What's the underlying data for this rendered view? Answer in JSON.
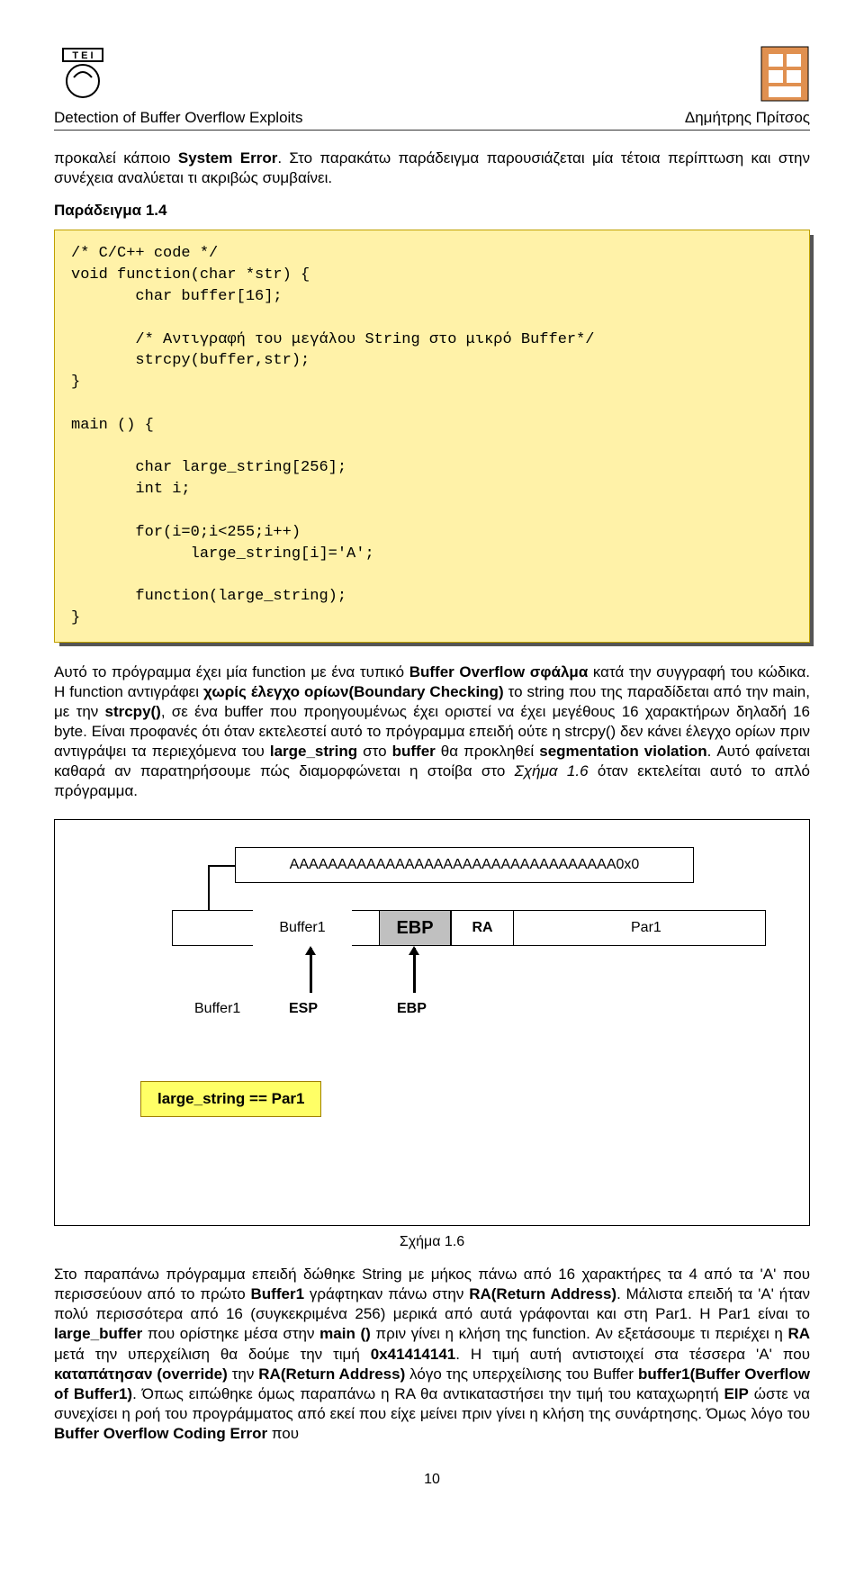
{
  "header": {
    "title_left": "Detection of Buffer Overflow Exploits",
    "title_right": "Δημήτρης Πρίτσος"
  },
  "intro_para": {
    "t1": "προκαλεί κάποιο ",
    "b1": "System Error",
    "t2": ". Στο παρακάτω παράδειγμα παρουσιάζεται μία τέτοια περίπτωση και στην συνέχεια αναλύεται τι ακριβώς συμβαίνει."
  },
  "example_label": "Παράδειγμα 1.4",
  "code": "/* C/C++ code */\nvoid function(char *str) {\n       char buffer[16];\n\n       /* Αντιγραφή του μεγάλου String στο μικρό Buffer*/\n       strcpy(buffer,str);\n}\n\nmain () {\n\n       char large_string[256];\n       int i;\n\n       for(i=0;i<255;i++)\n             large_string[i]='A';\n\n       function(large_string);\n}",
  "para2": {
    "t1": "Αυτό το πρόγραμμα έχει μία function με ένα τυπικό ",
    "b1": "Buffer Overflow σφάλμα",
    "t2": " κατά την συγγραφή του κώδικα. Η function αντιγράφει ",
    "b2": "χωρίς έλεγχο ορίων(Boundary Checking)",
    "t3": " το string που της παραδίδεται από την main, με την ",
    "b3": "strcpy()",
    "t4": ", σε ένα buffer που προηγουμένως έχει οριστεί να έχει μεγέθους 16 χαρακτήρων δηλαδή 16 byte. Είναι προφανές ότι όταν εκτελεστεί αυτό το πρόγραμμα επειδή ούτε η strcpy() δεν κάνει έλεγχο ορίων πριν αντιγράψει τα περιεχόμενα του ",
    "b4": "large_string",
    "t5": " στο ",
    "b5": "buffer",
    "t6": " θα προκληθεί ",
    "b6": "segmentation violation",
    "t7": ". Αυτό φαίνεται καθαρά αν παρατηρήσουμε πώς διαμορφώνεται η στοίβα στο ",
    "i1": "Σχήμα 1.6",
    "t8": " όταν εκτελείται αυτό το απλό πρόγραμμα."
  },
  "diagram": {
    "aaaa": "AAAAAAAAAAAAAAAAAAAAAAAAAAAAAAAAAA0x0",
    "buffer1a": "Buffer1",
    "ebp_box": "EBP",
    "ra": "RA",
    "par1": "Par1",
    "buffer1b": "Buffer1",
    "esp": "ESP",
    "ebp_lbl": "EBP",
    "large_string": "large_string == Par1"
  },
  "caption": "Σχήμα 1.6",
  "para3": {
    "t1": "Στο παραπάνω πρόγραμμα επειδή δώθηκε String με μήκος πάνω από 16 χαρακτήρες τα 4 από τα 'A' που περισσεύουν από το πρώτο ",
    "b1": "Buffer1",
    "t2": " γράφτηκαν πάνω στην ",
    "b2": "RA(Return Address)",
    "t3": ". Μάλιστα επειδή τα 'A' ήταν πολύ περισσότερα από 16 (συγκεκριμένα 256) μερικά από αυτά γράφονται και στη Par1. Η Par1 είναι το ",
    "b3": "large_buffer",
    "t4": " που ορίστηκε μέσα στην ",
    "b4": "main ()",
    "t5": " πριν γίνει η κλήση της function. Αν εξετάσουμε τι περιέχει η ",
    "b5": "RA",
    "t6": " μετά την υπερχείλιση θα δούμε την τιμή ",
    "b6": "0x41414141",
    "t7": ". Η τιμή αυτή αντιστοιχεί στα τέσσερα 'A' που ",
    "b7": "καταπάτησαν (override)",
    "t8": " την ",
    "b8": "RA(Return Address)",
    "t9": " λόγο της υπερχείλισης του Buffer ",
    "b9": "buffer1(Buffer Overflow of Buffer1)",
    "t10": ". Όπως ειπώθηκε όμως παραπάνω η RA θα αντικαταστήσει την τιμή του καταχωρητή ",
    "b10": "EIP",
    "t11": " ώστε να συνεχίσει η ροή του προγράμματος από εκεί που είχε μείνει πριν γίνει η κλήση της συνάρτησης. Όμως λόγο του ",
    "b11": "Buffer Overflow Coding Error",
    "t12": " που"
  },
  "pagenum": "10"
}
